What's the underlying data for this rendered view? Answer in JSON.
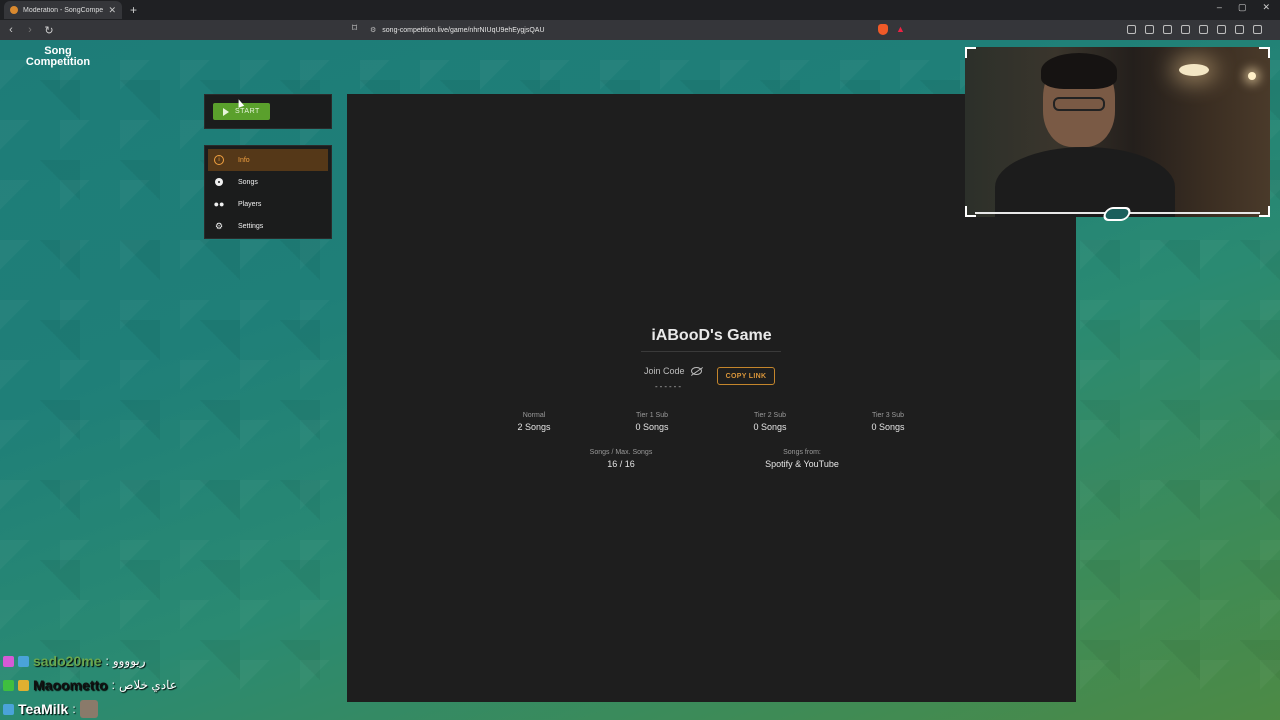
{
  "browser": {
    "tab_title": "Moderation - SongCompetition",
    "url": "song-competition.live/game/nhrNIUqU9ehEygjsQAU",
    "window_controls": [
      "–",
      "▢",
      "✕"
    ]
  },
  "site": {
    "logo_line1": "Song",
    "logo_line2": "Competition"
  },
  "controls": {
    "start_label": "START"
  },
  "menu": {
    "items": [
      {
        "label": "Info",
        "icon": "info-icon",
        "active": true
      },
      {
        "label": "Songs",
        "icon": "music-icon",
        "active": false
      },
      {
        "label": "Players",
        "icon": "users-icon",
        "active": false
      },
      {
        "label": "Settings",
        "icon": "gear-icon",
        "active": false
      }
    ]
  },
  "game": {
    "title": "iABooD's Game",
    "join_label": "Join Code",
    "join_code": "------",
    "copy_label": "COPY LINK",
    "stats": [
      {
        "label": "Normal",
        "value": "2 Songs"
      },
      {
        "label": "Tier 1 Sub",
        "value": "0 Songs"
      },
      {
        "label": "Tier 2 Sub",
        "value": "0 Songs"
      },
      {
        "label": "Tier 3 Sub",
        "value": "0 Songs"
      }
    ],
    "songs_max_label": "Songs / Max. Songs",
    "songs_max_value": "16 / 16",
    "songs_from_label": "Songs from:",
    "songs_from_value": "Spotify & YouTube"
  },
  "chat": [
    {
      "name": "sado20me",
      "separator": " :",
      "message": "ريوووو",
      "name_color": "#6aa84f"
    },
    {
      "name": "Maoometto",
      "separator": " :",
      "message": "عادي خلاص",
      "name_color": "#111111"
    },
    {
      "name": "TeaMilk",
      "separator": " :",
      "message": "",
      "name_color": "#ffffff"
    }
  ],
  "colors": {
    "accent": "#f0a040",
    "start_green": "#5aa02c",
    "panel_bg": "#1e1e1e"
  }
}
